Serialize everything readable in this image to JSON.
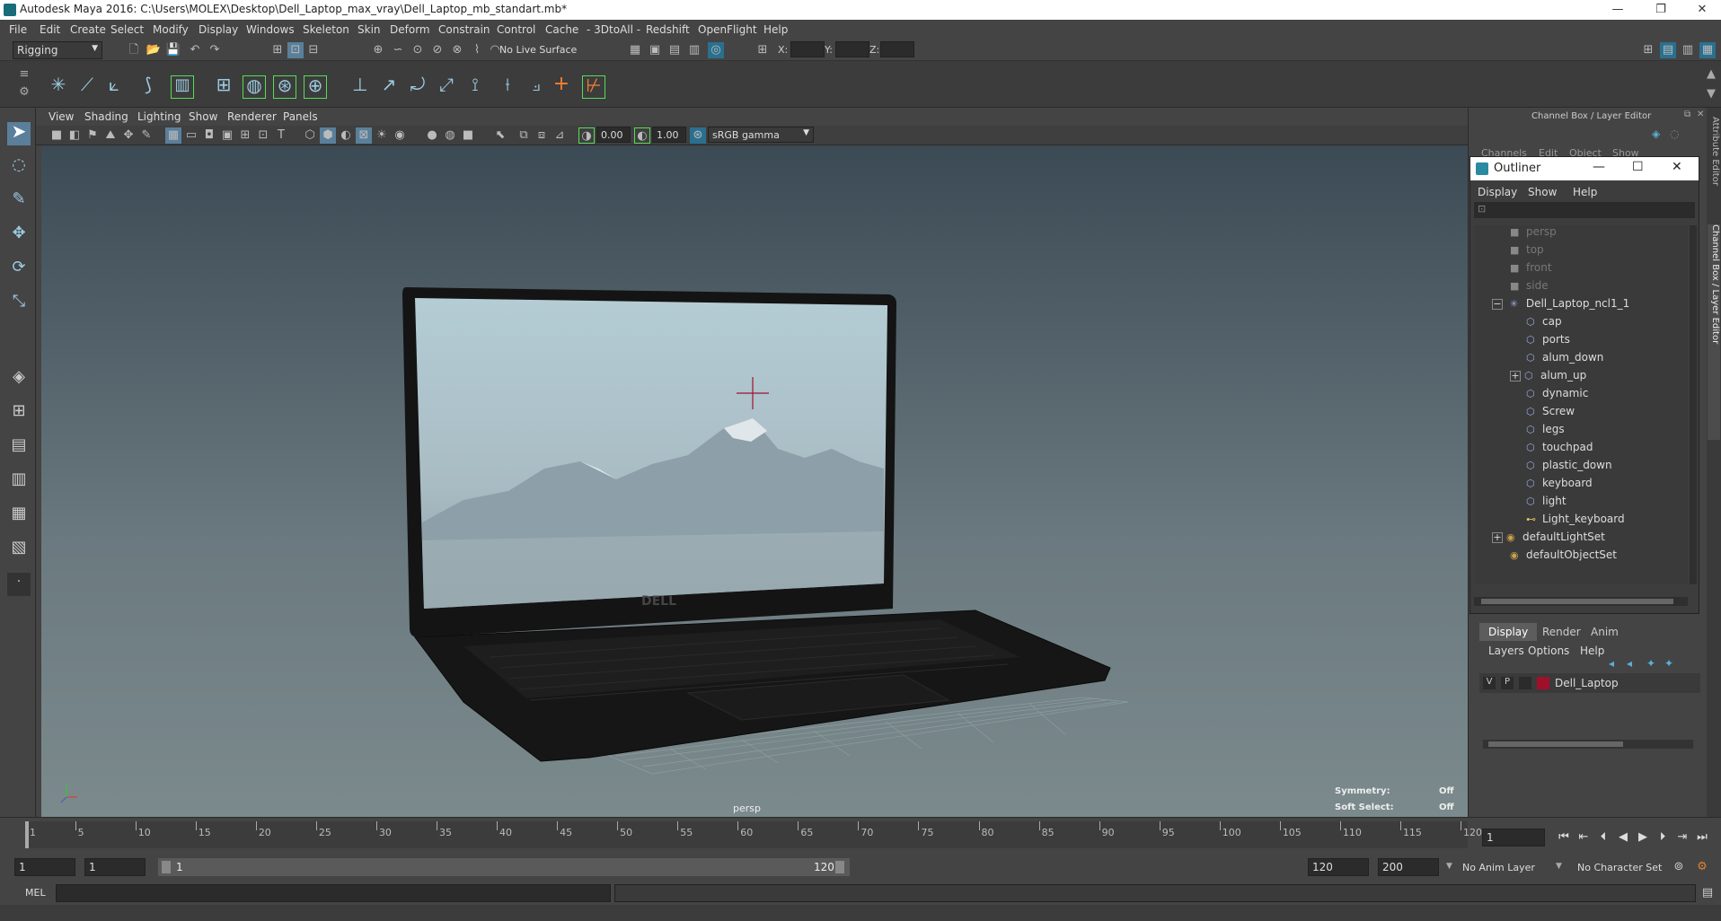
{
  "window": {
    "title": "Autodesk Maya 2016: C:\\Users\\MOLEX\\Desktop\\Dell_Laptop_max_vray\\Dell_Laptop_mb_standart.mb*",
    "minimize": "—",
    "maximize": "❐",
    "close": "✕"
  },
  "menubar": [
    "File",
    "Edit",
    "Create",
    "Select",
    "Modify",
    "Display",
    "Windows",
    "Skeleton",
    "Skin",
    "Deform",
    "Constrain",
    "Control",
    "Cache",
    "- 3DtoAll -",
    "Redshift",
    "OpenFlight",
    "Help"
  ],
  "statusline": {
    "mode": "Rigging",
    "live_surface": "No Live Surface",
    "x_label": "X:",
    "y_label": "Y:",
    "z_label": "Z:"
  },
  "panel": {
    "menus": [
      "View",
      "Shading",
      "Lighting",
      "Show",
      "Renderer",
      "Panels"
    ],
    "exposure": "0.00",
    "gamma": "1.00",
    "color_space": "sRGB gamma"
  },
  "viewport": {
    "camera_label": "persp",
    "symmetry_label": "Symmetry:",
    "symmetry_value": "Off",
    "soft_select_label": "Soft Select:",
    "soft_select_value": "Off",
    "logo_text": "DELL"
  },
  "channel_box": {
    "title": "Channel Box / Layer Editor",
    "menus": [
      "Channels",
      "Edit",
      "Object",
      "Show"
    ]
  },
  "side_tabs": [
    "Attribute Editor",
    "Channel Box / Layer Editor"
  ],
  "outliner": {
    "title": "Outliner",
    "menus": [
      "Display",
      "Show",
      "Help"
    ],
    "cameras": [
      "persp",
      "top",
      "front",
      "side"
    ],
    "root": "Dell_Laptop_ncl1_1",
    "children": [
      "cap",
      "ports",
      "alum_down",
      "alum_up",
      "dynamic",
      "Screw",
      "legs",
      "touchpad",
      "plastic_down",
      "keyboard",
      "light",
      "Light_keyboard"
    ],
    "sets": [
      "defaultLightSet",
      "defaultObjectSet"
    ]
  },
  "layer_editor": {
    "tabs": [
      "Display",
      "Render",
      "Anim"
    ],
    "active_tab": "Display",
    "menus": [
      "Layers",
      "Options",
      "Help"
    ],
    "layer": {
      "v": "V",
      "p": "P",
      "name": "Dell_Laptop",
      "color": "#a0102a"
    }
  },
  "timeline": {
    "ticks": [
      "1",
      "5",
      "10",
      "15",
      "20",
      "25",
      "30",
      "35",
      "40",
      "45",
      "50",
      "55",
      "60",
      "65",
      "70",
      "75",
      "80",
      "85",
      "90",
      "95",
      "100",
      "105",
      "110",
      "115",
      "120"
    ],
    "current_frame": "1"
  },
  "range": {
    "start": "1",
    "playback_start": "1",
    "slider_start": "1",
    "slider_end": "120",
    "playback_end": "120",
    "end": "200",
    "anim_layer": "No Anim Layer",
    "character_set": "No Character Set"
  },
  "command": {
    "label": "MEL"
  },
  "help": {
    "text": ""
  },
  "colors": {
    "accent": "#5ab0d8",
    "outliner_icon": "#9ad"
  }
}
